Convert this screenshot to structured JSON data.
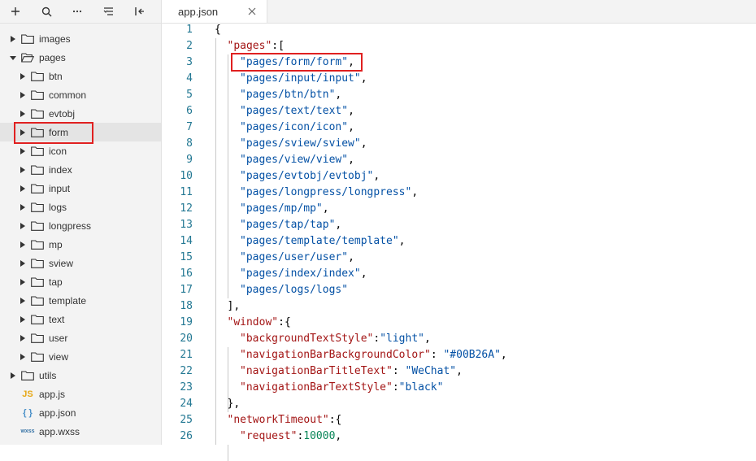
{
  "toolbar": {
    "icons": [
      "plus-icon",
      "search-icon",
      "more-icon",
      "collapse-all-icon",
      "toggle-sidebar-icon"
    ]
  },
  "tree": [
    {
      "label": "images",
      "kind": "folder",
      "depth": 0,
      "expanded": false
    },
    {
      "label": "pages",
      "kind": "folder",
      "depth": 0,
      "expanded": true
    },
    {
      "label": "btn",
      "kind": "folder",
      "depth": 1,
      "expanded": false
    },
    {
      "label": "common",
      "kind": "folder",
      "depth": 1,
      "expanded": false
    },
    {
      "label": "evtobj",
      "kind": "folder",
      "depth": 1,
      "expanded": false
    },
    {
      "label": "form",
      "kind": "folder",
      "depth": 1,
      "expanded": false,
      "selected": true
    },
    {
      "label": "icon",
      "kind": "folder",
      "depth": 1,
      "expanded": false
    },
    {
      "label": "index",
      "kind": "folder",
      "depth": 1,
      "expanded": false
    },
    {
      "label": "input",
      "kind": "folder",
      "depth": 1,
      "expanded": false
    },
    {
      "label": "logs",
      "kind": "folder",
      "depth": 1,
      "expanded": false
    },
    {
      "label": "longpress",
      "kind": "folder",
      "depth": 1,
      "expanded": false
    },
    {
      "label": "mp",
      "kind": "folder",
      "depth": 1,
      "expanded": false
    },
    {
      "label": "sview",
      "kind": "folder",
      "depth": 1,
      "expanded": false
    },
    {
      "label": "tap",
      "kind": "folder",
      "depth": 1,
      "expanded": false
    },
    {
      "label": "template",
      "kind": "folder",
      "depth": 1,
      "expanded": false
    },
    {
      "label": "text",
      "kind": "folder",
      "depth": 1,
      "expanded": false
    },
    {
      "label": "user",
      "kind": "folder",
      "depth": 1,
      "expanded": false
    },
    {
      "label": "view",
      "kind": "folder",
      "depth": 1,
      "expanded": false
    },
    {
      "label": "utils",
      "kind": "folder",
      "depth": 0,
      "expanded": false
    },
    {
      "label": "app.js",
      "kind": "js",
      "icon_text": "JS",
      "depth": 0
    },
    {
      "label": "app.json",
      "kind": "json",
      "icon_text": "{ }",
      "depth": 0
    },
    {
      "label": "app.wxss",
      "kind": "wxss",
      "icon_text": "wxss",
      "depth": 0
    }
  ],
  "tab": {
    "label": "app.json"
  },
  "code_lines": [
    {
      "n": "1",
      "indent": 0,
      "tokens": [
        [
          "p",
          "{"
        ]
      ]
    },
    {
      "n": "2",
      "indent": 1,
      "tokens": [
        [
          "k",
          "\"pages\""
        ],
        [
          "p",
          ":["
        ]
      ]
    },
    {
      "n": "3",
      "indent": 2,
      "tokens": [
        [
          "s",
          "\"pages/form/form\""
        ],
        [
          "p",
          ","
        ]
      ]
    },
    {
      "n": "4",
      "indent": 2,
      "tokens": [
        [
          "s",
          "\"pages/input/input\""
        ],
        [
          "p",
          ","
        ]
      ]
    },
    {
      "n": "5",
      "indent": 2,
      "tokens": [
        [
          "s",
          "\"pages/btn/btn\""
        ],
        [
          "p",
          ","
        ]
      ]
    },
    {
      "n": "6",
      "indent": 2,
      "tokens": [
        [
          "s",
          "\"pages/text/text\""
        ],
        [
          "p",
          ","
        ]
      ]
    },
    {
      "n": "7",
      "indent": 2,
      "tokens": [
        [
          "s",
          "\"pages/icon/icon\""
        ],
        [
          "p",
          ","
        ]
      ]
    },
    {
      "n": "8",
      "indent": 2,
      "tokens": [
        [
          "s",
          "\"pages/sview/sview\""
        ],
        [
          "p",
          ","
        ]
      ]
    },
    {
      "n": "9",
      "indent": 2,
      "tokens": [
        [
          "s",
          "\"pages/view/view\""
        ],
        [
          "p",
          ","
        ]
      ]
    },
    {
      "n": "10",
      "indent": 2,
      "tokens": [
        [
          "s",
          "\"pages/evtobj/evtobj\""
        ],
        [
          "p",
          ","
        ]
      ]
    },
    {
      "n": "11",
      "indent": 2,
      "tokens": [
        [
          "s",
          "\"pages/longpress/longpress\""
        ],
        [
          "p",
          ","
        ]
      ]
    },
    {
      "n": "12",
      "indent": 2,
      "tokens": [
        [
          "s",
          "\"pages/mp/mp\""
        ],
        [
          "p",
          ","
        ]
      ]
    },
    {
      "n": "13",
      "indent": 2,
      "tokens": [
        [
          "s",
          "\"pages/tap/tap\""
        ],
        [
          "p",
          ","
        ]
      ]
    },
    {
      "n": "14",
      "indent": 2,
      "tokens": [
        [
          "s",
          "\"pages/template/template\""
        ],
        [
          "p",
          ","
        ]
      ]
    },
    {
      "n": "15",
      "indent": 2,
      "tokens": [
        [
          "s",
          "\"pages/user/user\""
        ],
        [
          "p",
          ","
        ]
      ]
    },
    {
      "n": "16",
      "indent": 2,
      "tokens": [
        [
          "s",
          "\"pages/index/index\""
        ],
        [
          "p",
          ","
        ]
      ]
    },
    {
      "n": "17",
      "indent": 2,
      "tokens": [
        [
          "s",
          "\"pages/logs/logs\""
        ]
      ]
    },
    {
      "n": "18",
      "indent": 1,
      "tokens": [
        [
          "p",
          "],"
        ]
      ]
    },
    {
      "n": "19",
      "indent": 1,
      "tokens": [
        [
          "k",
          "\"window\""
        ],
        [
          "p",
          ":{"
        ]
      ]
    },
    {
      "n": "20",
      "indent": 2,
      "tokens": [
        [
          "k",
          "\"backgroundTextStyle\""
        ],
        [
          "p",
          ":"
        ],
        [
          "s",
          "\"light\""
        ],
        [
          "p",
          ","
        ]
      ]
    },
    {
      "n": "21",
      "indent": 2,
      "tokens": [
        [
          "k",
          "\"navigationBarBackgroundColor\""
        ],
        [
          "p",
          ": "
        ],
        [
          "s",
          "\"#00B26A\""
        ],
        [
          "p",
          ","
        ]
      ]
    },
    {
      "n": "22",
      "indent": 2,
      "tokens": [
        [
          "k",
          "\"navigationBarTitleText\""
        ],
        [
          "p",
          ": "
        ],
        [
          "s",
          "\"WeChat\""
        ],
        [
          "p",
          ","
        ]
      ]
    },
    {
      "n": "23",
      "indent": 2,
      "tokens": [
        [
          "k",
          "\"navigationBarTextStyle\""
        ],
        [
          "p",
          ":"
        ],
        [
          "s",
          "\"black\""
        ]
      ]
    },
    {
      "n": "24",
      "indent": 1,
      "tokens": [
        [
          "p",
          "},"
        ]
      ]
    },
    {
      "n": "25",
      "indent": 1,
      "tokens": [
        [
          "k",
          "\"networkTimeout\""
        ],
        [
          "p",
          ":{"
        ]
      ]
    },
    {
      "n": "26",
      "indent": 2,
      "tokens": [
        [
          "k",
          "\"request\""
        ],
        [
          "p",
          ":"
        ],
        [
          "n",
          "10000"
        ],
        [
          "p",
          ","
        ]
      ]
    }
  ],
  "colors": {
    "highlight_box": "#e02020",
    "key": "#a31515",
    "string": "#0451a5",
    "number": "#098658",
    "line_number": "#237893"
  }
}
